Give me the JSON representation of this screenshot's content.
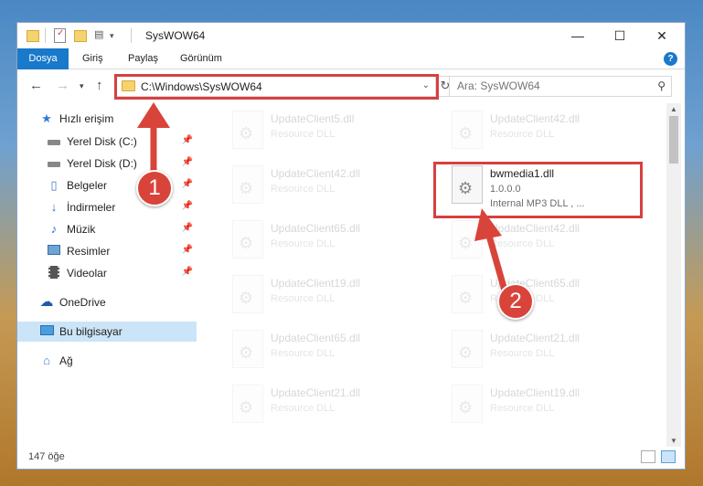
{
  "window": {
    "title": "SysWOW64",
    "controls": {
      "minimize": "—",
      "maximize": "☐",
      "close": "✕"
    }
  },
  "ribbon": {
    "tabs": [
      "Dosya",
      "Giriş",
      "Paylaş",
      "Görünüm"
    ],
    "help": "?"
  },
  "nav": {
    "address": "C:\\Windows\\SysWOW64",
    "search_placeholder": "Ara: SysWOW64"
  },
  "sidebar": {
    "items": [
      {
        "label": "Hızlı erişim",
        "icon": "star-icon"
      },
      {
        "label": "Yerel Disk (C:)",
        "icon": "drive-icon"
      },
      {
        "label": "Yerel Disk (D:)",
        "icon": "drive-icon"
      },
      {
        "label": "Belgeler",
        "icon": "documents-icon"
      },
      {
        "label": "İndirmeler",
        "icon": "download-icon"
      },
      {
        "label": "Müzik",
        "icon": "music-icon"
      },
      {
        "label": "Resimler",
        "icon": "pictures-icon"
      },
      {
        "label": "Videolar",
        "icon": "video-icon"
      },
      {
        "label": "OneDrive",
        "icon": "cloud-icon"
      },
      {
        "label": "Bu bilgisayar",
        "icon": "computer-icon"
      },
      {
        "label": "Ağ",
        "icon": "network-icon"
      }
    ]
  },
  "files": [
    {
      "name": "UpdateClient5.dll",
      "type": "Resource DLL"
    },
    {
      "name": "UpdateClient42.dll",
      "type": "Resource DLL"
    },
    {
      "name": "UpdateClient42.dll",
      "type": "Resource DLL"
    },
    {
      "name": "bwmedia1.dll",
      "version": "1.0.0.0",
      "description": "Internal MP3 DLL , ..."
    },
    {
      "name": "UpdateClient65.dll",
      "type": "Resource DLL"
    },
    {
      "name": "UpdateClient42.dll",
      "type": "Resource DLL"
    },
    {
      "name": "UpdateClient19.dll",
      "type": "Resource DLL"
    },
    {
      "name": "UpdateClient65.dll",
      "type": "Resource DLL"
    },
    {
      "name": "UpdateClient65.dll",
      "type": "Resource DLL"
    },
    {
      "name": "UpdateClient21.dll",
      "type": "Resource DLL"
    },
    {
      "name": "UpdateClient21.dll",
      "type": "Resource DLL"
    },
    {
      "name": "UpdateClient19.dll",
      "type": "Resource DLL"
    }
  ],
  "status": {
    "count": "147 öğe"
  },
  "annotations": {
    "step1": "1",
    "step2": "2",
    "color": "#d64040"
  }
}
